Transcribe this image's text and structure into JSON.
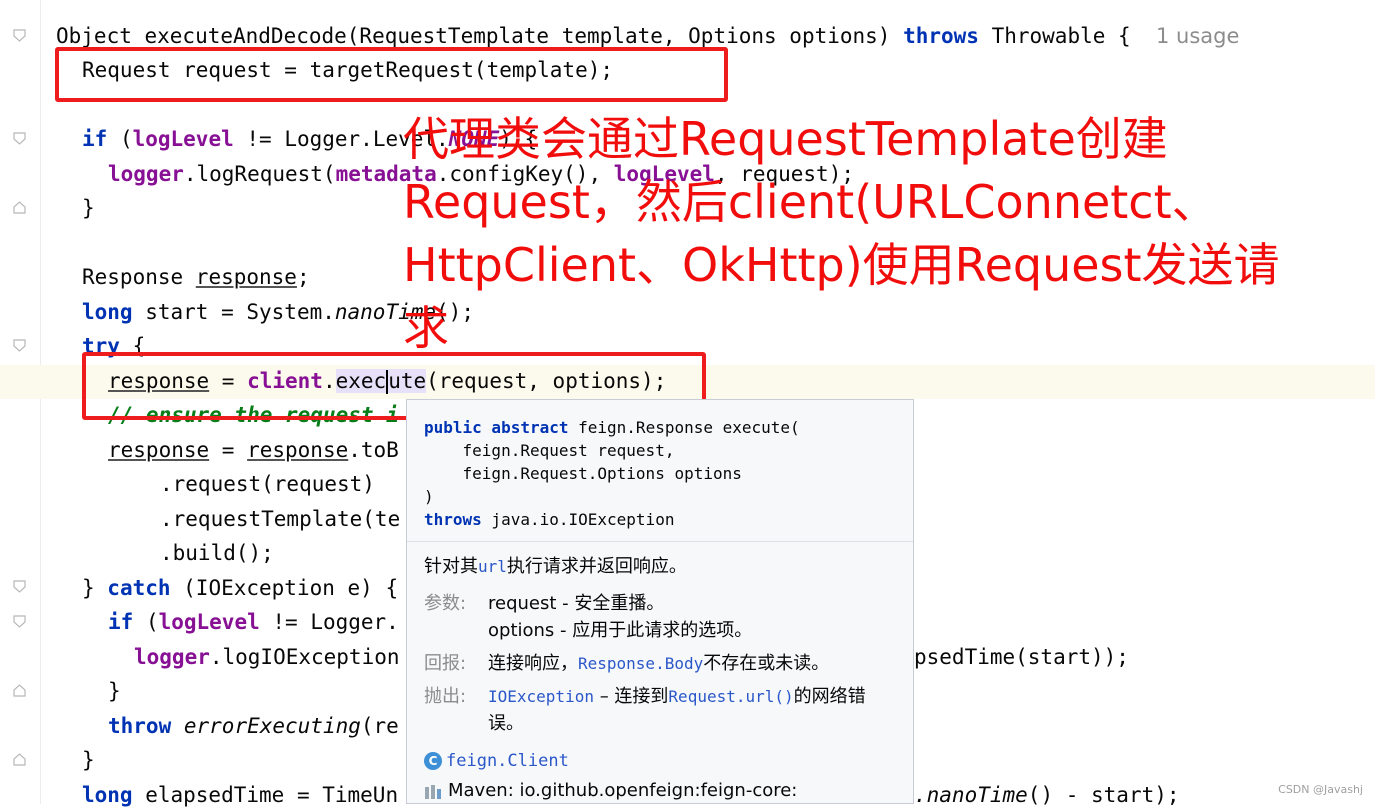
{
  "editor": {
    "line1": {
      "p1": "Object executeAndDecode(RequestTemplate template, Options options) ",
      "kw": "throws",
      "p2": " Throwable {",
      "hint": "1 usage"
    },
    "line2": "Request request = targetRequest(template);",
    "line3": {
      "kw": "if",
      "p1": " (",
      "fld": "logLevel",
      "p2": " != Logger.Level.",
      "enum": "NONE",
      "p3": ") {"
    },
    "line4": {
      "fld1": "logger",
      "p1": ".logRequest(",
      "fld2": "metadata",
      "p2": ".configKey(), ",
      "fld3": "logLevel",
      "p3": ", request);"
    },
    "line5": "}",
    "line6": {
      "p1": "Response ",
      "var": "response",
      "p2": ";"
    },
    "line7": {
      "kw": "long",
      "p1": " start = System.",
      "it": "nanoTime",
      "p2": "();"
    },
    "line8": {
      "kw": "try",
      "p1": " {"
    },
    "line9": {
      "var": "response",
      "p1": " = ",
      "fld": "client",
      "p2": ".",
      "m1": "exec",
      "m2": "ute",
      "p3": "(request, options);"
    },
    "line10": "// ensure the request i",
    "line11": {
      "var1": "response",
      "p1": " = ",
      "var2": "response",
      "p2": ".toB"
    },
    "line12": ".request(request)",
    "line13": ".requestTemplate(te",
    "line14": ".build();",
    "line15": {
      "p1": "} ",
      "kw": "catch",
      "p2": " (IOException e) {"
    },
    "line16": {
      "kw": "if",
      "p1": " (",
      "fld": "logLevel",
      "p2": " != Logger."
    },
    "line17": {
      "fld": "logger",
      "p1": ".logIOException",
      "tail": "psedTime(start));"
    },
    "line18": "}",
    "line19": {
      "kw": "throw",
      "p1": " ",
      "it": "errorExecuting",
      "p2": "(re"
    },
    "line20": "}",
    "line21": {
      "kw": "long",
      "p1": " elapsedTime = TimeUn",
      "it": ".nanoTime",
      "p2": "() - start);"
    }
  },
  "annotation": {
    "text": "代理类会通过RequestTemplate创建Request，然后client(URLConnetct、HttpClient、OkHttp)使用Request发送请求"
  },
  "popup": {
    "sig_kw1": "public abstract",
    "sig_p1": " feign.Response execute(",
    "sig_l2": "    feign.Request request,",
    "sig_l3": "    feign.Request.Options options",
    "sig_l4": ")",
    "sig_kw2": "throws",
    "sig_p5": " java.io.IOException",
    "desc_p1": "针对其",
    "desc_link": "url",
    "desc_p2": "执行请求并返回响应。",
    "params_label": "参数:",
    "param1": "request - 安全重播。",
    "param2": "options - 应用于此请求的选项。",
    "returns_label": "回报:",
    "returns_p1": "连接响应，",
    "returns_link": "Response.Body",
    "returns_p2": "不存在或未读。",
    "throws_label": "抛出:",
    "throws_link1": "IOException",
    "throws_p1": " – 连接到",
    "throws_link2": "Request.url()",
    "throws_p2": "的网络错误。",
    "class_icon": "C",
    "class_name": "feign.Client",
    "maven": "Maven: io.github.openfeign:feign-core:"
  },
  "icons": {
    "fold": "fold-arrow-icon",
    "class": "class-icon",
    "maven": "maven-library-icon"
  },
  "colors": {
    "keyword": "#0033b3",
    "field": "#871094",
    "annotation": "#f20d0d",
    "link": "#2b57c9"
  },
  "watermark": "CSDN @Javashj"
}
